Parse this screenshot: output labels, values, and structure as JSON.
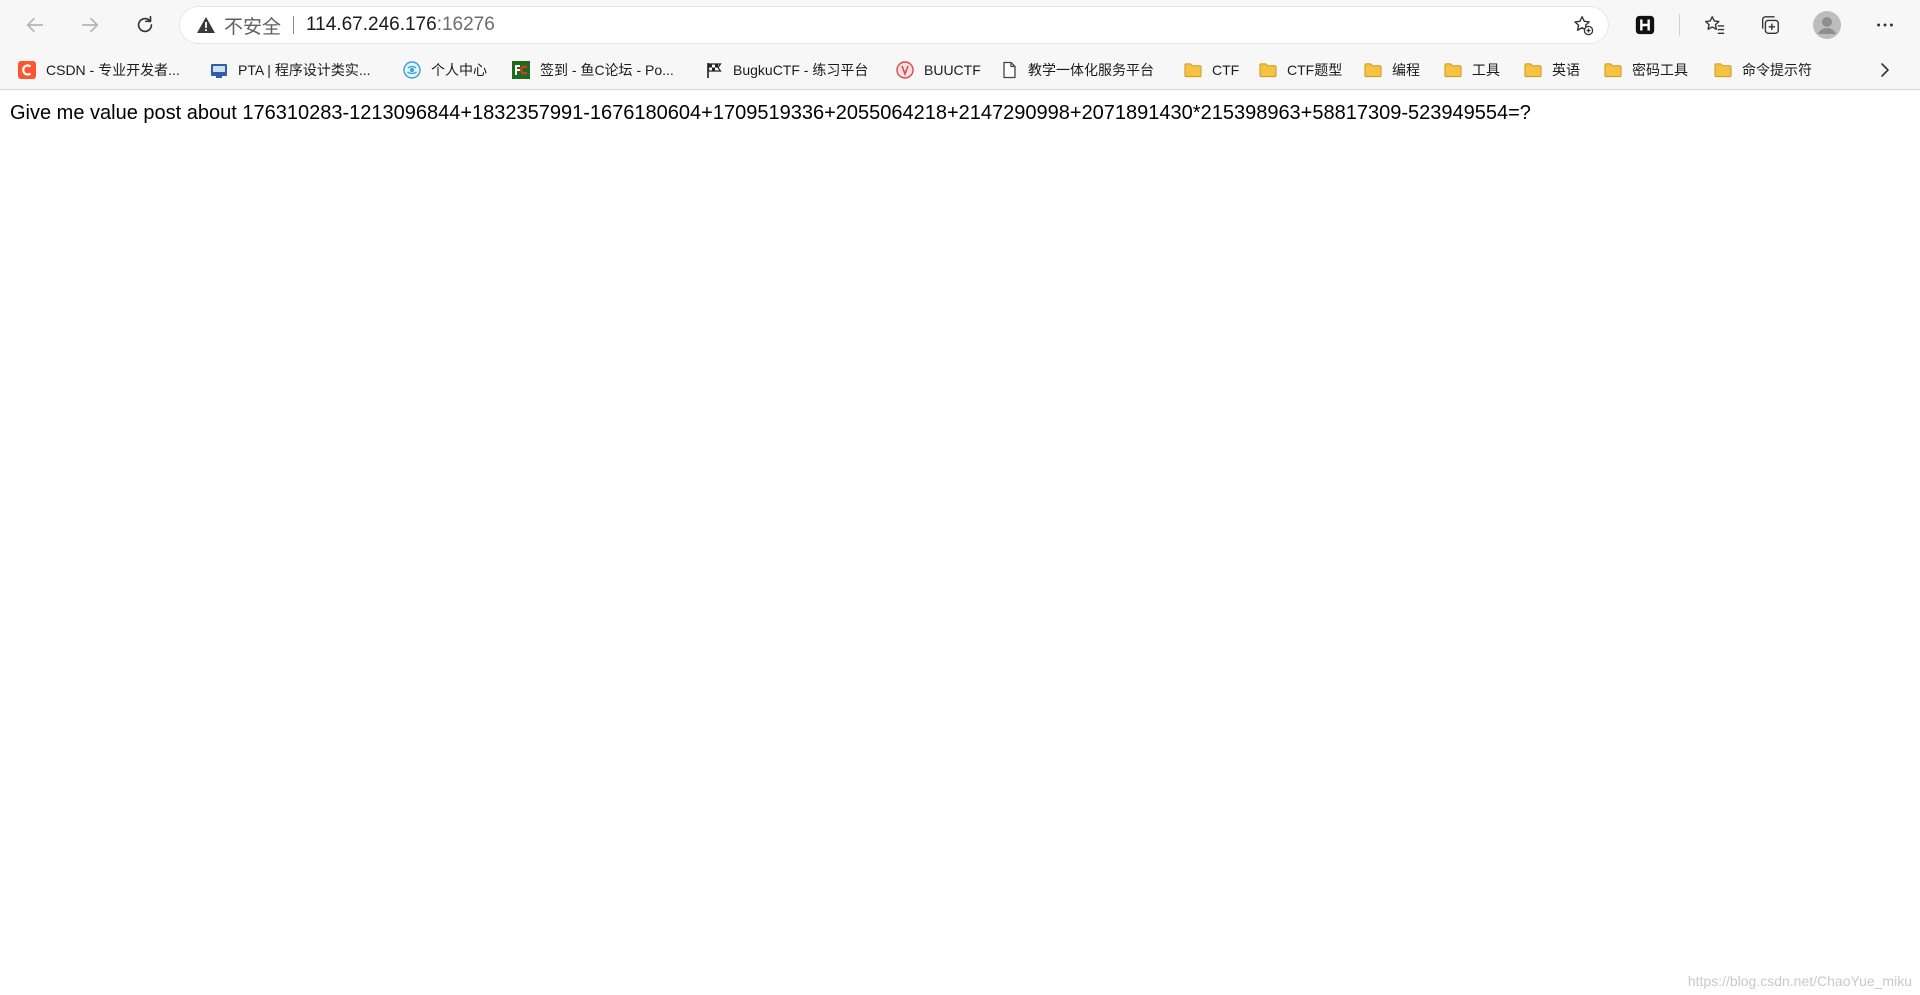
{
  "address": {
    "security_label": "不安全",
    "host": "114.67.246.176",
    "port": ":16276"
  },
  "icons": {
    "back": "back-arrow-icon",
    "forward": "forward-arrow-icon",
    "refresh": "refresh-icon",
    "warning": "warning-triangle-icon",
    "favorite_add": "star-plus-icon",
    "extension": "h-extension-icon",
    "favorites": "favorites-icon",
    "collections": "collections-icon",
    "profile": "profile-avatar-icon",
    "more": "ellipsis-icon",
    "bookmarks_more": "chevron-right-icon"
  },
  "bookmarks": [
    {
      "label": "CSDN - 专业开发者...",
      "icon": "csdn-icon"
    },
    {
      "label": "PTA | 程序设计类实...",
      "icon": "pta-icon"
    },
    {
      "label": "个人中心",
      "icon": "globe-icon"
    },
    {
      "label": "签到 - 鱼C论坛 - Po...",
      "icon": "fishc-icon"
    },
    {
      "label": "BugkuCTF - 练习平台",
      "icon": "flag-icon"
    },
    {
      "label": "BUUCTF",
      "icon": "buuctf-icon"
    },
    {
      "label": "教学一体化服务平台",
      "icon": "page-icon"
    },
    {
      "label": "CTF",
      "icon": "folder-icon"
    },
    {
      "label": "CTF题型",
      "icon": "folder-icon"
    },
    {
      "label": "编程",
      "icon": "folder-icon"
    },
    {
      "label": "工具",
      "icon": "folder-icon"
    },
    {
      "label": "英语",
      "icon": "folder-icon"
    },
    {
      "label": "密码工具",
      "icon": "folder-icon"
    },
    {
      "label": "命令提示符",
      "icon": "folder-icon"
    }
  ],
  "page": {
    "message": "Give me value post about 176310283-1213096844+1832357991-1676180604+1709519336+2055064218+2147290998+2071891430*215398963+58817309-523949554=?"
  },
  "watermark": "https://blog.csdn.net/ChaoYue_miku",
  "colors": {
    "folder": "#f5c242",
    "csdn": "#fc5531",
    "accent": "#1b1b1b"
  }
}
